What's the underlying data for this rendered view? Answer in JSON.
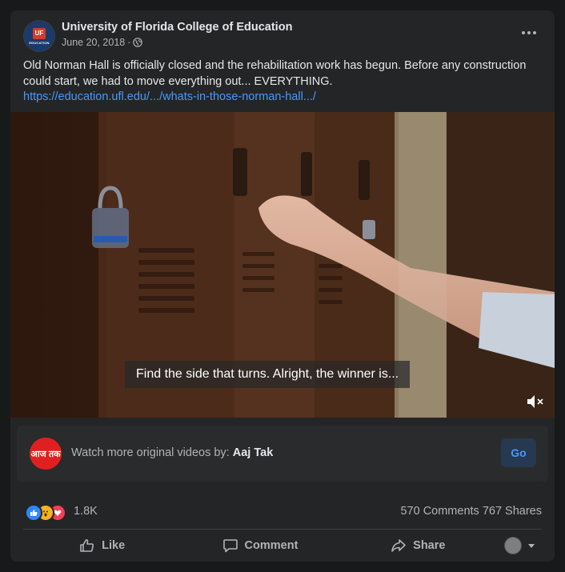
{
  "post": {
    "page_name": "University of Florida College of Education",
    "date": "June 20, 2018",
    "separator": "·",
    "text": "Old Norman Hall is officially closed and the rehabilitation work has begun. Before any construction could start, we had to move everything out... EVERYTHING.",
    "link": "https://education.ufl.edu/.../whats-in-those-norman-hall.../",
    "avatar": {
      "logo_text": "UF",
      "sub_text": "EDUCATION"
    }
  },
  "video": {
    "subtitle": "Find the side that turns. Alright, the winner is...",
    "mute_icon": "speaker-muted-icon"
  },
  "promo": {
    "prefix": "Watch more original videos by:",
    "channel": "Aaj Tak",
    "logo_text": "आज तक",
    "button": "Go"
  },
  "stats": {
    "reaction_count": "1.8K",
    "comments": "570 Comments",
    "shares": "767 Shares",
    "reactions": [
      "like-icon",
      "wow-icon",
      "love-icon"
    ]
  },
  "actions": {
    "like": "Like",
    "comment": "Comment",
    "share": "Share"
  },
  "colors": {
    "background": "#18191a",
    "card": "#242526",
    "link": "#4599ff",
    "like_blue": "#2d88ff",
    "love_red": "#f33e58",
    "wow_yellow": "#f7b125"
  }
}
